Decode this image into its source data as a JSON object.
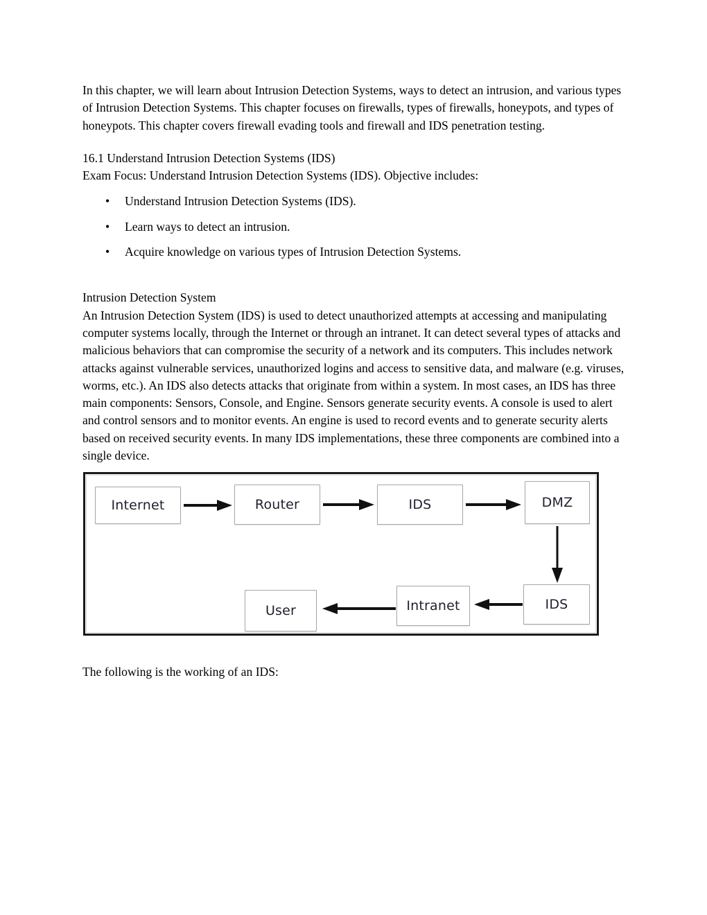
{
  "document": {
    "intro_paragraph": "In this chapter, we will learn about Intrusion Detection Systems, ways to detect an intrusion, and various types of Intrusion Detection Systems. This chapter focuses on firewalls, types of firewalls, honeypots, and types of honeypots. This chapter covers firewall evading tools and firewall and IDS penetration testing.",
    "section_heading": "16.1 Understand Intrusion Detection Systems (IDS)",
    "exam_focus_line": "Exam Focus: Understand Intrusion Detection Systems (IDS). Objective includes:",
    "objectives": [
      {
        "bullet": "•",
        "text": "Understand Intrusion Detection Systems (IDS)."
      },
      {
        "bullet": "•",
        "text": "Learn ways to detect an intrusion."
      },
      {
        "bullet": "•",
        "text": "Acquire knowledge on various types of Intrusion Detection Systems."
      }
    ],
    "subsection_title": "Intrusion Detection System",
    "body_paragraph": "An Intrusion Detection System (IDS) is used to detect unauthorized attempts at accessing and manipulating computer systems locally, through the Internet or through an intranet. It can detect several types of attacks and malicious behaviors that can compromise the security of a network and its computers. This includes network attacks against vulnerable services, unauthorized logins and access to sensitive data, and malware (e.g. viruses, worms, etc.). An IDS also detects attacks that originate from within a system. In most cases, an IDS has three main components: Sensors, Console, and Engine. Sensors generate security events. A console is used to alert and control sensors and to monitor events. An engine is used to record events and to generate security alerts based on received security events. In many IDS implementations, these three components are combined into a single device.",
    "closing_line": "The following is the working of an IDS:"
  },
  "diagram": {
    "frame_color": "#1a1a1a",
    "node_border_color": "#a6a6a6",
    "node_text_color": "#1f1f2e",
    "arrow_color": "#111111",
    "nodes": [
      {
        "id": "internet",
        "label": "Internet"
      },
      {
        "id": "router",
        "label": "Router"
      },
      {
        "id": "ids-top",
        "label": "IDS"
      },
      {
        "id": "dmz",
        "label": "DMZ"
      },
      {
        "id": "ids-bottom",
        "label": "IDS"
      },
      {
        "id": "intranet",
        "label": "Intranet"
      },
      {
        "id": "user",
        "label": "User"
      }
    ],
    "edges": [
      {
        "from": "internet",
        "to": "router",
        "direction": "right"
      },
      {
        "from": "router",
        "to": "ids-top",
        "direction": "right"
      },
      {
        "from": "ids-top",
        "to": "dmz",
        "direction": "right"
      },
      {
        "from": "dmz",
        "to": "ids-bottom",
        "direction": "down"
      },
      {
        "from": "ids-bottom",
        "to": "intranet",
        "direction": "left"
      },
      {
        "from": "intranet",
        "to": "user",
        "direction": "left"
      }
    ]
  }
}
